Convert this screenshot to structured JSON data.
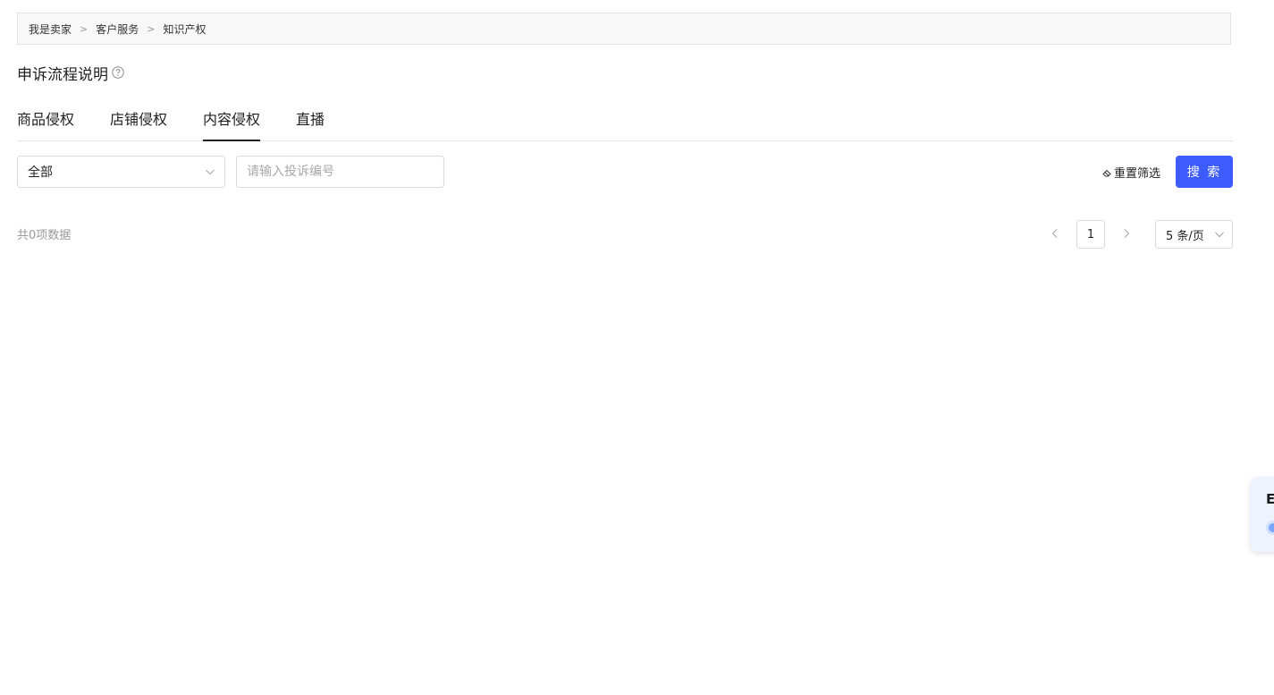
{
  "breadcrumb": {
    "items": [
      "我是卖家",
      "客户服务",
      "知识产权"
    ],
    "separator": ">"
  },
  "title": {
    "text": "申诉流程说明",
    "help_icon": "question-circle-icon"
  },
  "tabs": [
    {
      "label": "商品侵权",
      "active": false
    },
    {
      "label": "店铺侵权",
      "active": false
    },
    {
      "label": "内容侵权",
      "active": true
    },
    {
      "label": "直播",
      "active": false
    }
  ],
  "filters": {
    "type_select": {
      "value": "全部"
    },
    "complaint_no": {
      "value": "",
      "placeholder": "请输入投诉编号"
    },
    "reset_label": "重置筛选",
    "search_label": "搜 索"
  },
  "results": {
    "total_text": "共0项数据"
  },
  "pagination": {
    "current_page": "1",
    "page_size_label": "5 条/页"
  },
  "floating_widget": {
    "text": "E"
  },
  "colors": {
    "primary": "#3d5cff",
    "text": "#1f1f1f",
    "muted": "#999999",
    "border": "#d9d9d9",
    "breadcrumb_bg": "#f8f8f8"
  }
}
